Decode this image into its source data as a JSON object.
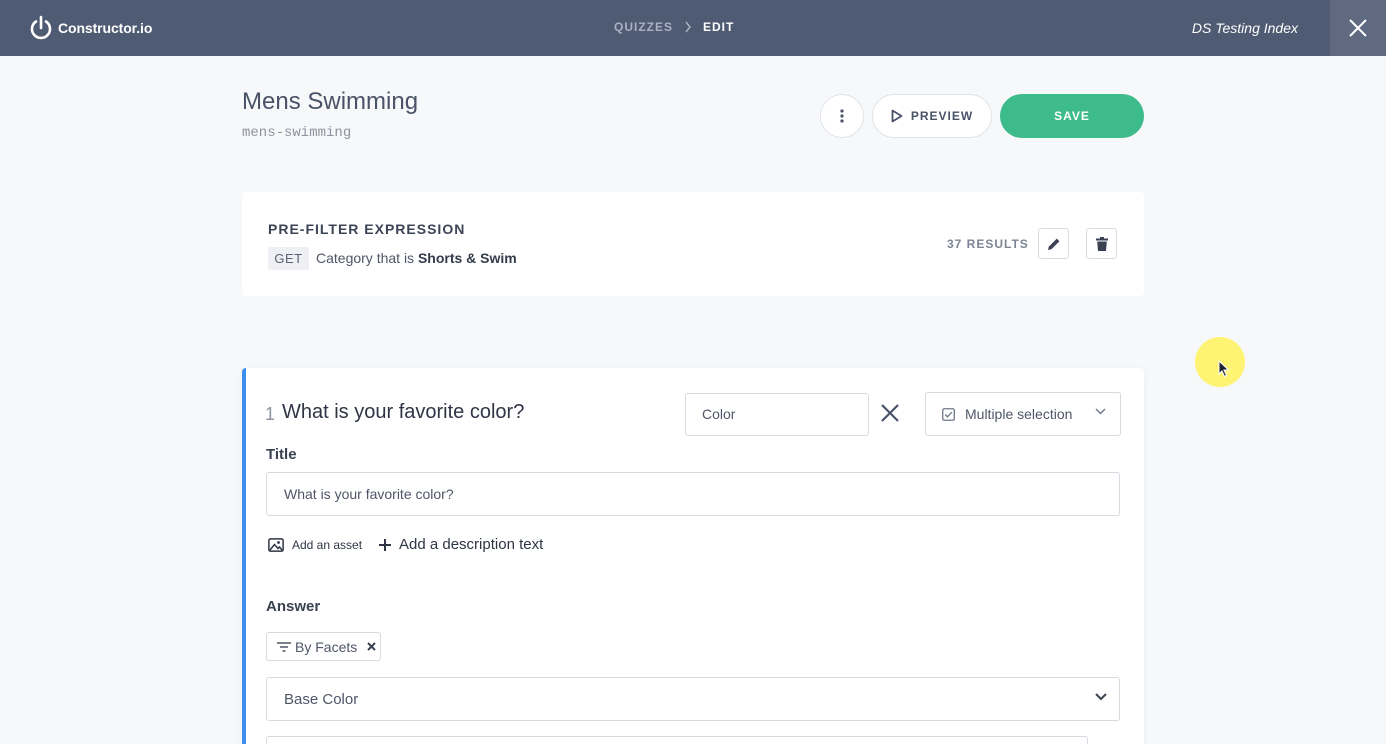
{
  "app": {
    "logo_text": "Constructor.io",
    "index_name": "DS Testing Index"
  },
  "breadcrumb": {
    "items": [
      "QUIZZES",
      "EDIT"
    ]
  },
  "quiz": {
    "title": "Mens Swimming",
    "slug": "mens-swimming",
    "preview_label": "PREVIEW",
    "save_label": "SAVE"
  },
  "prefilter": {
    "heading": "PRE-FILTER EXPRESSION",
    "method": "GET",
    "expression_prefix": "Category that is",
    "expression_value": "Shorts & Swim",
    "results": "37 RESULTS"
  },
  "question": {
    "number": "1",
    "title": "What is your favorite color?",
    "key_value": "Color",
    "type": "Multiple selection",
    "title_label": "Title",
    "title_value": "What is your favorite color?",
    "add_asset": "Add an asset",
    "add_description": "Add a description text",
    "answer_label": "Answer",
    "answer_filter": "By Facets",
    "facet_select": "Base Color"
  },
  "colors": {
    "topbar": "#4f5b73",
    "save": "#3dbb8a",
    "accent": "#3d8fef"
  }
}
